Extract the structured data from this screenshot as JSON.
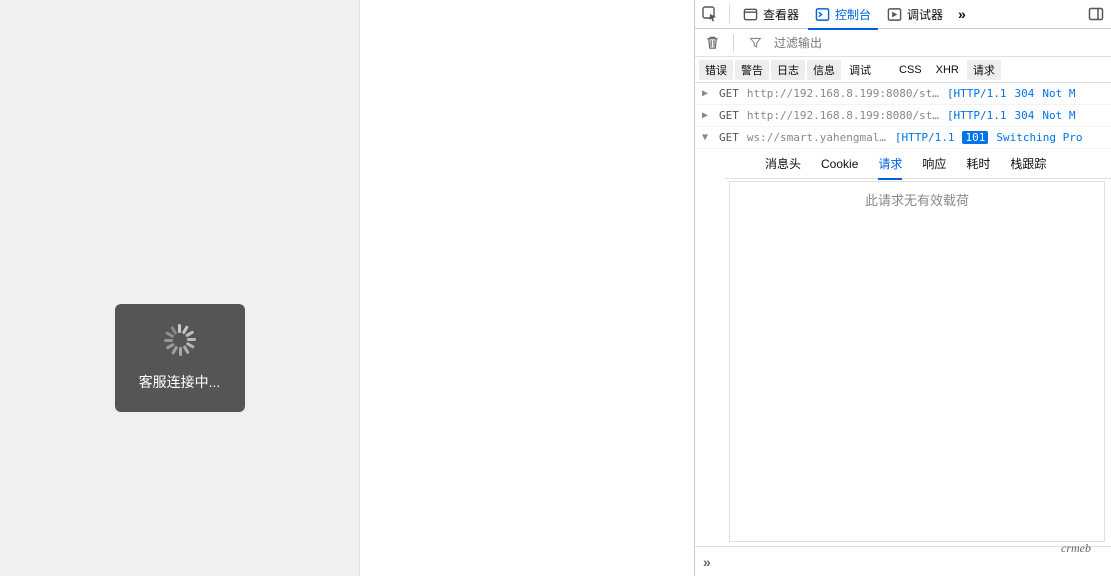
{
  "loading": {
    "text": "客服连接中..."
  },
  "devtools": {
    "tabs": {
      "inspector": "查看器",
      "console": "控制台",
      "debugger": "调试器"
    },
    "filter_placeholder": "过滤输出",
    "categories": {
      "errors": "错误",
      "warnings": "警告",
      "logs": "日志",
      "info": "信息",
      "debug": "调试",
      "css": "CSS",
      "xhr": "XHR",
      "requests": "请求"
    },
    "rows": [
      {
        "disclosed": false,
        "method": "GET",
        "url": "http://192.168.8.199:8080/st…",
        "proto": "[HTTP/1.1",
        "code": "304",
        "code_class": "code304",
        "status": "Not M"
      },
      {
        "disclosed": false,
        "method": "GET",
        "url": "http://192.168.8.199:8080/st…",
        "proto": "[HTTP/1.1",
        "code": "304",
        "code_class": "code304",
        "status": "Not M"
      },
      {
        "disclosed": true,
        "method": "GET",
        "url": "ws://smart.yahengmal…",
        "proto": "[HTTP/1.1",
        "code": "101",
        "code_class": "code101",
        "status": "Switching Pro"
      }
    ],
    "detail_tabs": {
      "headers": "消息头",
      "cookie": "Cookie",
      "request": "请求",
      "response": "响应",
      "timing": "耗时",
      "stack": "栈跟踪"
    },
    "no_payload": "此请求无有效载荷",
    "more": "»"
  },
  "watermark": "crmeb"
}
